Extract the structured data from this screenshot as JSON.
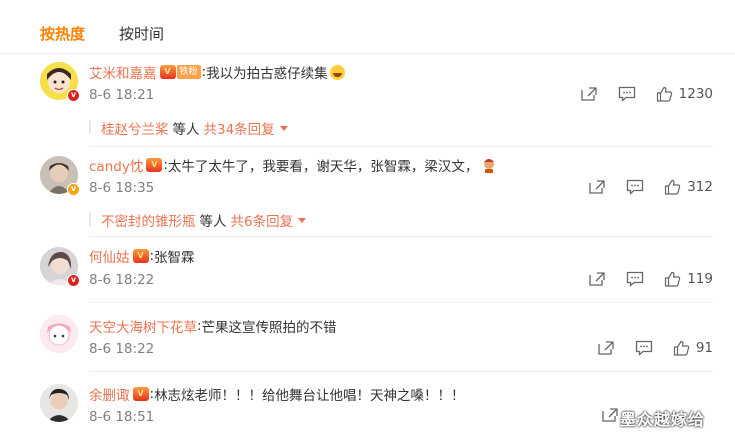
{
  "tabs": [
    {
      "label": "按热度"
    },
    {
      "label": "按时间"
    }
  ],
  "comments": [
    {
      "username": "艾米和嘉嘉",
      "fan_badge": "铁粉",
      "text": "我以为拍古惑仔续集",
      "emoji": "laugh-cry-emoji",
      "time": "8-6 18:21",
      "like_count": "1230",
      "reply_user": "桂赵兮兰桨",
      "reply_mid": "等人",
      "reply_more": "共34条回复"
    },
    {
      "username": "candy忱",
      "text": "太牛了太牛了，我要看，谢天华，张智霖，梁汉文，",
      "emoji": "rich-emoji",
      "time": "8-6 18:35",
      "like_count": "312",
      "reply_user": "不密封的锥形瓶",
      "reply_mid": "等人",
      "reply_more": "共6条回复"
    },
    {
      "username": "何仙姑",
      "text": "张智霖",
      "time": "8-6 18:22",
      "like_count": "119"
    },
    {
      "username": "天空大海树下花草",
      "text": "芒果这宣传照拍的不错",
      "time": "8-6 18:22",
      "like_count": "91"
    },
    {
      "username": "余删诹",
      "text": "林志炫老师！！！给他舞台让他唱！天神之嗓！！！",
      "time": "8-6 18:51"
    }
  ],
  "watermark": "墨众越嫁给",
  "colors": {
    "accent": "#ff8200",
    "username": "#eb7350",
    "muted": "#808080"
  }
}
